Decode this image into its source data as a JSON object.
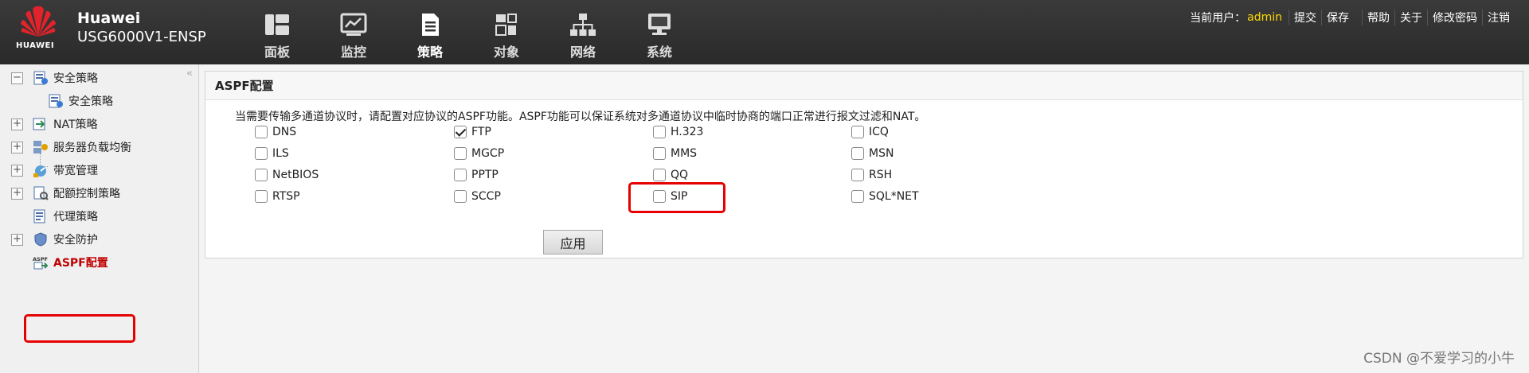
{
  "header": {
    "logo_text": "HUAWEI",
    "vendor": "Huawei",
    "model": "USG6000V1-ENSP",
    "nav": [
      {
        "label": "面板",
        "icon": "dashboard-icon"
      },
      {
        "label": "监控",
        "icon": "monitor-chart-icon"
      },
      {
        "label": "策略",
        "icon": "policy-document-icon",
        "active": true
      },
      {
        "label": "对象",
        "icon": "object-icon"
      },
      {
        "label": "网络",
        "icon": "network-topology-icon"
      },
      {
        "label": "系统",
        "icon": "system-computer-icon"
      }
    ],
    "user_label": "当前用户：",
    "user": "admin",
    "actions": [
      "提交",
      "保存",
      "帮助",
      "关于",
      "修改密码",
      "注销"
    ]
  },
  "sidebar": {
    "items": [
      {
        "label": "安全策略",
        "expander": "−"
      },
      {
        "label": "安全策略"
      },
      {
        "label": "NAT策略",
        "expander": "+"
      },
      {
        "label": "服务器负载均衡",
        "expander": "+"
      },
      {
        "label": "带宽管理",
        "expander": "+"
      },
      {
        "label": "配额控制策略",
        "expander": "+"
      },
      {
        "label": "代理策略"
      },
      {
        "label": "安全防护",
        "expander": "+"
      },
      {
        "label": "ASPF配置",
        "selected": true
      }
    ],
    "icon_text": "ASPF"
  },
  "main": {
    "panel_title": "ASPF配置",
    "description": "当需要传输多通道协议时，请配置对应协议的ASPF功能。ASPF功能可以保证系统对多通道协议中临时协商的端口正常进行报文过滤和NAT。",
    "protocols": [
      {
        "label": "DNS",
        "checked": false
      },
      {
        "label": "FTP",
        "checked": true
      },
      {
        "label": "H.323",
        "checked": false
      },
      {
        "label": "ICQ",
        "checked": false
      },
      {
        "label": "ILS",
        "checked": false
      },
      {
        "label": "MGCP",
        "checked": false
      },
      {
        "label": "MMS",
        "checked": false
      },
      {
        "label": "MSN",
        "checked": false
      },
      {
        "label": "NetBIOS",
        "checked": false
      },
      {
        "label": "PPTP",
        "checked": false
      },
      {
        "label": "QQ",
        "checked": false
      },
      {
        "label": "RSH",
        "checked": false
      },
      {
        "label": "RTSP",
        "checked": false
      },
      {
        "label": "SCCP",
        "checked": false
      },
      {
        "label": "SIP",
        "checked": false
      },
      {
        "label": "SQL*NET",
        "checked": false
      }
    ],
    "apply_label": "应用"
  },
  "watermark": "CSDN @不爱学习的小牛",
  "colors": {
    "header_bg": "#2f2f2f",
    "user_color": "#ffd800",
    "highlight": "#e60000",
    "selected_text": "#c00000"
  }
}
